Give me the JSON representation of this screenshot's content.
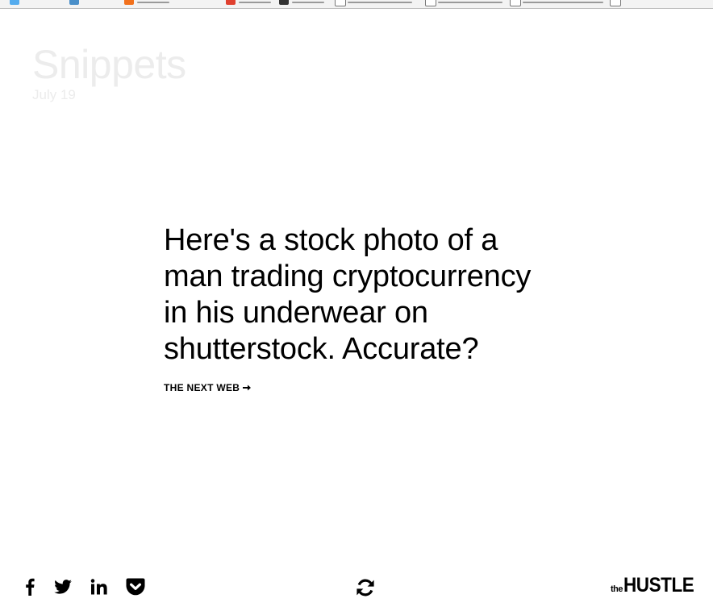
{
  "header": {
    "title": "Snippets",
    "date": "July 19"
  },
  "snippet": {
    "headline": "Here's a stock photo of a man trading cryptocurrency in his underwear on shutterstock. Accurate?",
    "source": "THE NEXT WEB"
  },
  "share": {
    "icons": [
      "facebook-icon",
      "twitter-icon",
      "linkedin-icon",
      "pocket-icon"
    ]
  },
  "controls": {
    "refresh_icon": "refresh-icon"
  },
  "brand": {
    "the": "the",
    "name": "HUSTLE"
  },
  "colors": {
    "background": "#ffffff",
    "text": "#000000",
    "faded_header": "#ececec"
  }
}
